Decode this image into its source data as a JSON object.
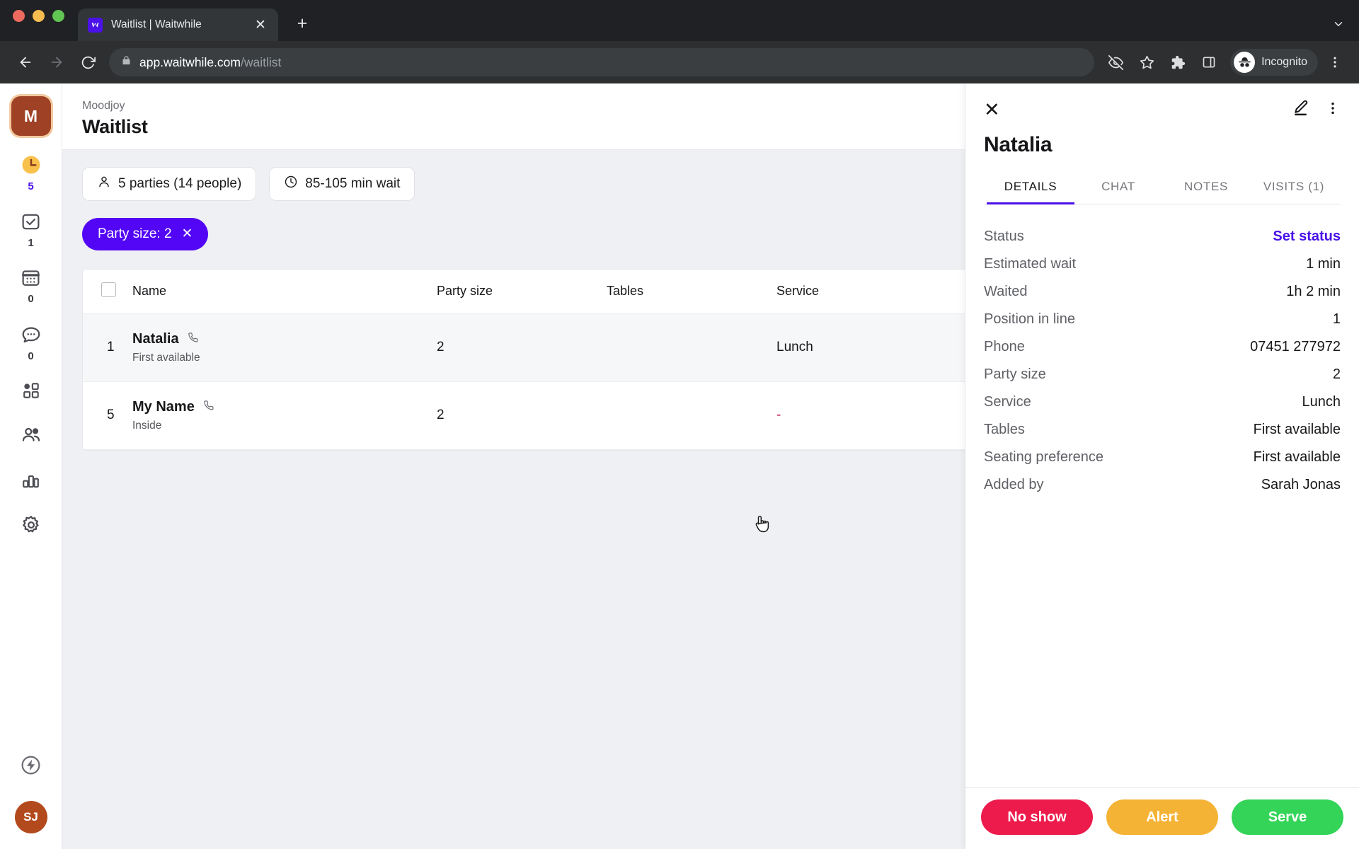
{
  "browser": {
    "tab": {
      "title": "Waitlist | Waitwhile",
      "favicon_letter": "W",
      "close_icon": "close-icon"
    },
    "new_tab_label": "+",
    "tabstrip_chevron": "chevron-down-icon",
    "url_host": "app.waitwhile.com",
    "url_path": "/waitlist",
    "back_icon": "back-arrow-icon",
    "forward_icon": "forward-arrow-icon",
    "reload_icon": "reload-icon",
    "lock_icon": "lock-icon",
    "toolbar_icons": [
      "eye-off-icon",
      "star-icon",
      "extensions-puzzle-icon",
      "side-panel-icon"
    ],
    "incognito_label": "Incognito",
    "menu_icon": "kebab-menu-icon"
  },
  "rail": {
    "logo_letter": "M",
    "items": [
      {
        "name": "waitlist",
        "icon": "clock-icon",
        "badge": "5"
      },
      {
        "name": "served",
        "icon": "check-square-icon",
        "badge": "1"
      },
      {
        "name": "bookings",
        "icon": "calendar-icon",
        "badge": "0"
      },
      {
        "name": "messages",
        "icon": "chat-bubble-icon",
        "badge": "0"
      },
      {
        "name": "apps",
        "icon": "grid-apps-icon",
        "badge": ""
      },
      {
        "name": "customers",
        "icon": "people-icon",
        "badge": ""
      },
      {
        "name": "analytics",
        "icon": "bar-chart-icon",
        "badge": ""
      },
      {
        "name": "settings",
        "icon": "gear-icon",
        "badge": ""
      }
    ],
    "bottom": {
      "power_icon": "bolt-circle-icon",
      "avatar_initials": "SJ"
    }
  },
  "header": {
    "breadcrumb": "Moodjoy",
    "title": "Waitlist"
  },
  "stats": [
    {
      "icon": "person-icon",
      "label": "5 parties (14 people)"
    },
    {
      "icon": "clock-icon",
      "label": "85-105 min wait"
    }
  ],
  "filter_chip": {
    "label": "Party size: 2",
    "remove_icon": "close-icon"
  },
  "table": {
    "columns": [
      "",
      "Name",
      "Party size",
      "Tables",
      "Service"
    ],
    "rows": [
      {
        "position": "1",
        "name": "Natalia",
        "name_icon": "phone-icon",
        "subtitle": "First available",
        "party_size": "2",
        "tables": "",
        "service": "Lunch",
        "selected": true
      },
      {
        "position": "5",
        "name": "My Name",
        "name_icon": "phone-icon",
        "subtitle": "Inside",
        "party_size": "2",
        "tables": "",
        "service": "-",
        "selected": false
      }
    ]
  },
  "panel": {
    "close_icon": "close-icon",
    "edit_icon": "pencil-edit-icon",
    "more_icon": "kebab-menu-icon",
    "name": "Natalia",
    "tabs": [
      {
        "label": "DETAILS",
        "active": true
      },
      {
        "label": "CHAT",
        "active": false
      },
      {
        "label": "NOTES",
        "active": false
      },
      {
        "label": "VISITS (1)",
        "active": false
      }
    ],
    "details": [
      {
        "key": "Status",
        "value": "Set status",
        "is_link": true
      },
      {
        "key": "Estimated wait",
        "value": "1 min",
        "is_link": false
      },
      {
        "key": "Waited",
        "value": "1h 2 min",
        "is_link": false
      },
      {
        "key": "Position in line",
        "value": "1",
        "is_link": false
      },
      {
        "key": "Phone",
        "value": "07451 277972",
        "is_link": false
      },
      {
        "key": "Party size",
        "value": "2",
        "is_link": false
      },
      {
        "key": "Service",
        "value": "Lunch",
        "is_link": false
      },
      {
        "key": "Tables",
        "value": "First available",
        "is_link": false
      },
      {
        "key": "Seating preference",
        "value": "First available",
        "is_link": false
      },
      {
        "key": "Added by",
        "value": "Sarah Jonas",
        "is_link": false
      }
    ],
    "actions": [
      {
        "label": "No show",
        "color": "#ed1b4c"
      },
      {
        "label": "Alert",
        "color": "#f5b335"
      },
      {
        "label": "Serve",
        "color": "#33d457"
      }
    ]
  },
  "colors": {
    "accent": "#4a11e8",
    "chip": "#5206f5",
    "brand_brown": "#9e4124",
    "dash_red": "#b4113c"
  }
}
